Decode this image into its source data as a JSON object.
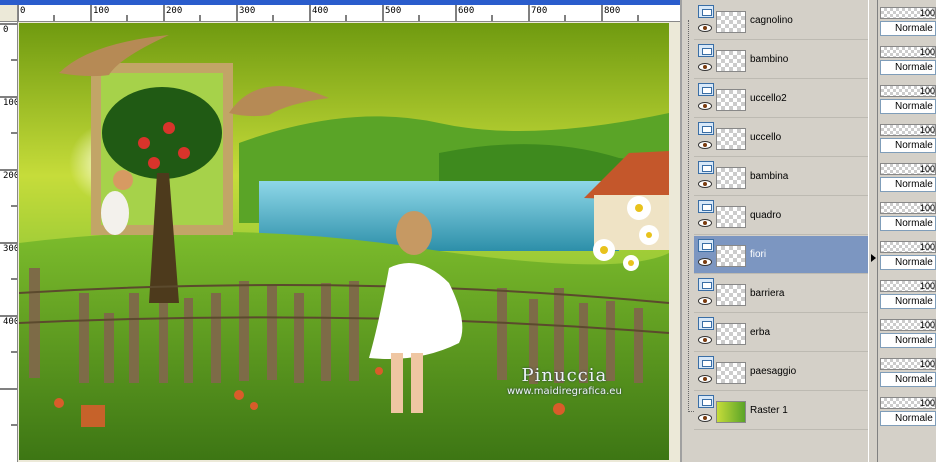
{
  "rulers": {
    "horizontal": [
      "0",
      "100",
      "200",
      "300",
      "400",
      "500",
      "600",
      "700",
      "800"
    ],
    "vertical": [
      "0",
      "100",
      "200",
      "300",
      "400"
    ]
  },
  "watermark": {
    "title": "Pinuccia",
    "subtitle": "www.maidiregrafica.eu"
  },
  "layers": [
    {
      "name": "cagnolino",
      "selected": false
    },
    {
      "name": "bambino",
      "selected": false
    },
    {
      "name": "uccello2",
      "selected": false
    },
    {
      "name": "uccello",
      "selected": false
    },
    {
      "name": "bambina",
      "selected": false
    },
    {
      "name": "quadro",
      "selected": false
    },
    {
      "name": "fiori",
      "selected": true
    },
    {
      "name": "barriera",
      "selected": false
    },
    {
      "name": "erba",
      "selected": false
    },
    {
      "name": "paesaggio",
      "selected": false
    },
    {
      "name": "Raster 1",
      "selected": false
    }
  ],
  "blend": [
    {
      "opacity": "100",
      "mode": "Normale"
    },
    {
      "opacity": "100",
      "mode": "Normale"
    },
    {
      "opacity": "100",
      "mode": "Normale"
    },
    {
      "opacity": "100",
      "mode": "Normale"
    },
    {
      "opacity": "100",
      "mode": "Normale"
    },
    {
      "opacity": "100",
      "mode": "Normale"
    },
    {
      "opacity": "100",
      "mode": "Normale"
    },
    {
      "opacity": "100",
      "mode": "Normale"
    },
    {
      "opacity": "100",
      "mode": "Normale"
    },
    {
      "opacity": "100",
      "mode": "Normale"
    },
    {
      "opacity": "100",
      "mode": "Normale"
    }
  ],
  "colors": {
    "selected_row": "#7c96c1",
    "panel_bg": "#d4d0c8"
  }
}
